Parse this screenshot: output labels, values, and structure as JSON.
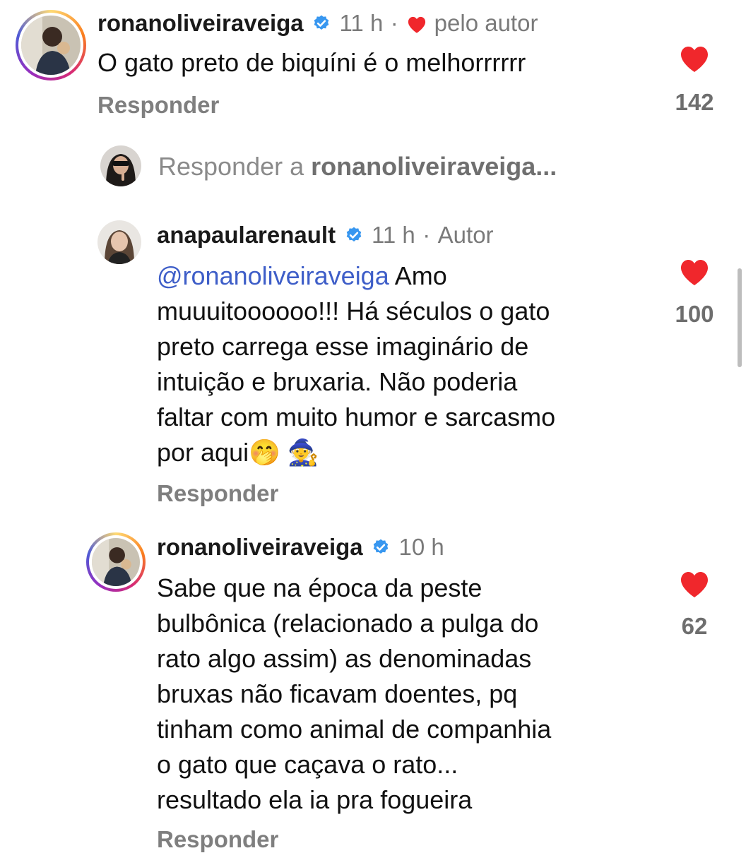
{
  "comments": [
    {
      "username": "ronanoliveiraveiga",
      "time": "11 h",
      "separator": "·",
      "liked_by_author_label": "pelo autor",
      "text": "O gato preto de biquíni é o melhorrrrrr",
      "reply_label": "Responder",
      "likes": "142"
    },
    {
      "username": "anapaularenault",
      "time": "11 h",
      "separator": "·",
      "author_label": "Autor",
      "mention": "@ronanoliveiraveiga",
      "lines": [
        " Amo",
        "muuuitoooooo!!! Há séculos o gato",
        "preto carrega esse imaginário de",
        "intuição e bruxaria. Não poderia",
        "faltar com muito humor e sarcasmo",
        "por aqui🤭 🧙"
      ],
      "reply_label": "Responder",
      "likes": "100"
    },
    {
      "username": "ronanoliveiraveiga",
      "time": "10 h",
      "lines": [
        "Sabe que na época da peste",
        "bulbônica (relacionado a pulga do",
        "rato algo assim) as denominadas",
        "bruxas não ficavam doentes, pq",
        "tinham como animal de companhia",
        "o gato que caçava o rato...",
        "resultado ela ia pra fogueira"
      ],
      "reply_label": "Responder",
      "likes": "62"
    }
  ],
  "reply_input": {
    "prefix": "Responder a ",
    "target": "ronanoliveiraveiga..."
  },
  "colors": {
    "heart": "#f0272c",
    "verified": "#3897f0",
    "mention": "#3e5ec8"
  }
}
